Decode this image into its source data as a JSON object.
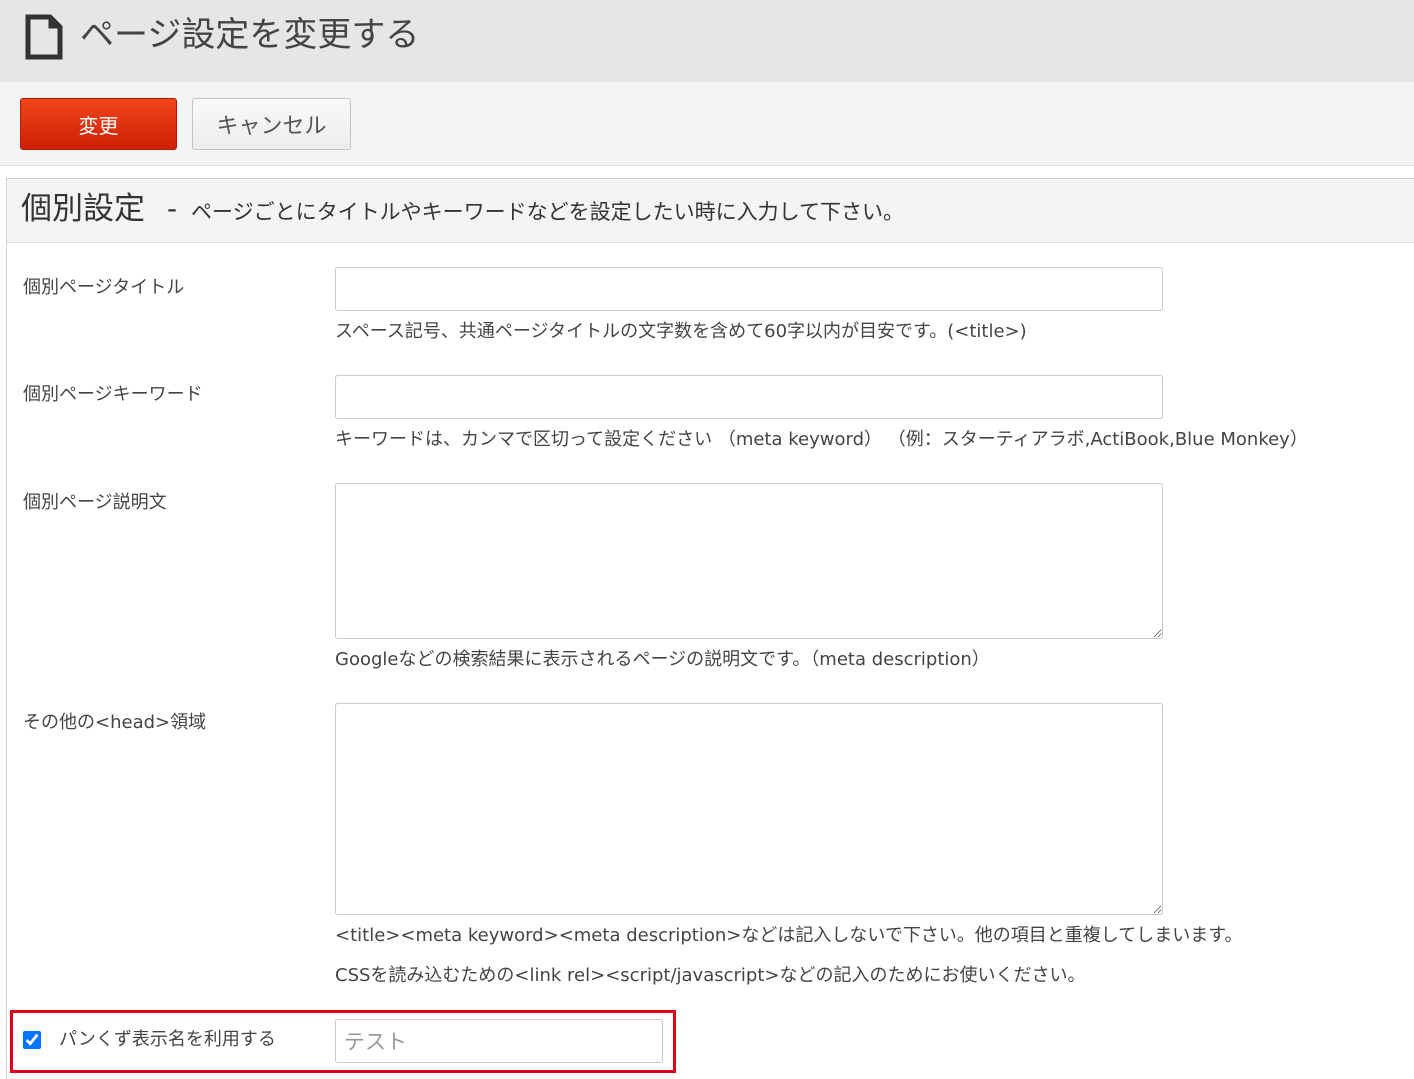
{
  "header": {
    "icon": "document-icon",
    "title": "ページ設定を変更する"
  },
  "toolbar": {
    "change_label": "変更",
    "cancel_label": "キャンセル"
  },
  "section": {
    "title": "個別設定",
    "separator": "-",
    "description": "ページごとにタイトルやキーワードなどを設定したい時に入力して下さい。"
  },
  "fields": {
    "page_title": {
      "label": "個別ページタイトル",
      "value": "",
      "help": "スペース記号、共通ページタイトルの文字数を含めて60字以内が目安です。(<title>)"
    },
    "page_keywords": {
      "label": "個別ページキーワード",
      "value": "",
      "help": "キーワードは、カンマで区切って設定ください （meta keyword） （例：スターティアラボ,ActiBook,Blue Monkey）"
    },
    "page_description": {
      "label": "個別ページ説明文",
      "value": "",
      "help": "Googleなどの検索結果に表示されるページの説明文です。（meta description）"
    },
    "head_area": {
      "label": "その他の<head>領域",
      "value": "",
      "help_1": "<title><meta keyword><meta description>などは記入しないで下さい。他の項目と重複してしまいます。",
      "help_2": "CSSを読み込むための<link rel><script/javascript>などの記入のためにお使いください。"
    }
  },
  "breadcrumb": {
    "checked": true,
    "label": "パンくず表示名を利用する",
    "value": "テスト"
  },
  "colors": {
    "primary_button": "#e0300f",
    "highlight_border": "#e0001a",
    "header_bg": "#e6e6e6"
  }
}
